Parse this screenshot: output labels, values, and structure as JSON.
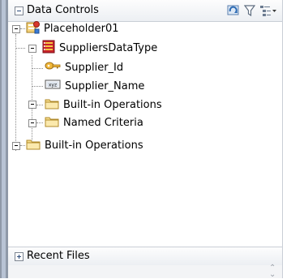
{
  "data_controls": {
    "title": "Data Controls",
    "toolbar_icons": [
      "refresh-icon",
      "filter-icon",
      "tree-options-icon"
    ],
    "tree": {
      "root": {
        "label": "Placeholder01",
        "icon": "placeholder-datacontrol-icon",
        "expanded": true
      },
      "datatype": {
        "label": "SuppliersDataType",
        "icon": "datatype-icon",
        "expanded": true
      },
      "attributes": [
        {
          "label": "Supplier_Id",
          "icon": "key-icon"
        },
        {
          "label": "Supplier_Name",
          "icon": "string-attribute-icon"
        }
      ],
      "datatype_folders": [
        {
          "label": "Built-in Operations",
          "icon": "folder-icon",
          "expanded": false
        },
        {
          "label": "Named Criteria",
          "icon": "folder-icon",
          "expanded": false
        }
      ],
      "root_folders": [
        {
          "label": "Built-in Operations",
          "icon": "folder-icon",
          "expanded": false
        }
      ]
    }
  },
  "recent_files": {
    "title": "Recent Files",
    "expanded": false
  }
}
